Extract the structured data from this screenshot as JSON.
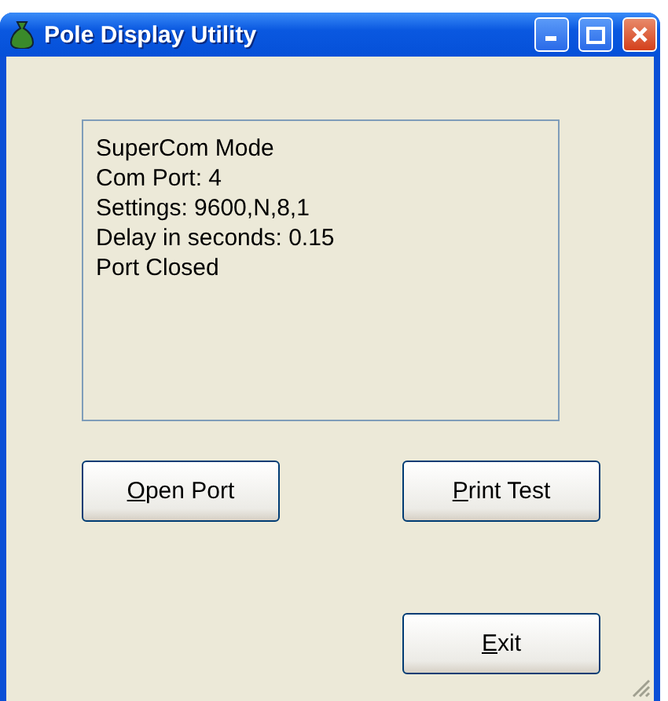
{
  "window": {
    "title": "Pole Display Utility"
  },
  "status_lines": [
    "SuperCom Mode",
    "Com Port: 4",
    "Settings: 9600,N,8,1",
    "Delay in seconds: 0.15",
    "Port Closed"
  ],
  "buttons": [
    {
      "key": "O",
      "rest": "pen Port"
    },
    {
      "key": "P",
      "rest": "rint Test"
    },
    {
      "key": "E",
      "rest": "xit"
    }
  ]
}
